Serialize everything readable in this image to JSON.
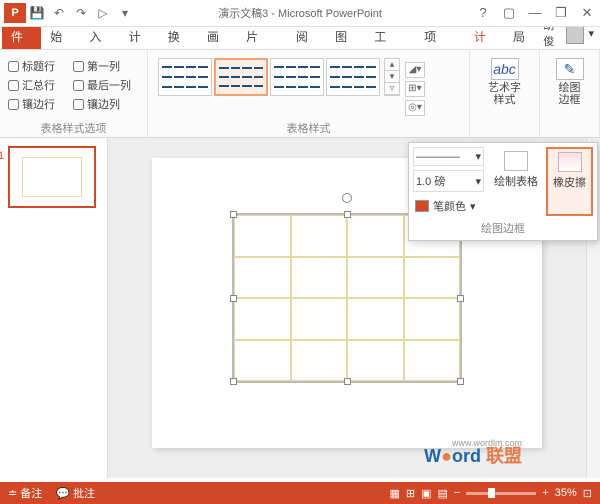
{
  "title": "演示文稿3 - Microsoft PowerPoint",
  "tabs": {
    "file": "文件",
    "start": "开始",
    "insert": "插入",
    "design": "设计",
    "trans": "切换",
    "anim": "动画",
    "slideshow": "幻灯片",
    "review": "审阅",
    "view": "视图",
    "dev": "开发工",
    "addin": "加载项",
    "design2": "设计",
    "layout": "布局"
  },
  "user": "胡俊",
  "checks": {
    "header_row": "标题行",
    "first_col": "第一列",
    "total_row": "汇总行",
    "last_col": "最后一列",
    "banded_row": "镶边行",
    "banded_col": "镶边列"
  },
  "groups": {
    "table_opts": "表格样式选项",
    "table_styles": "表格样式",
    "wordart": "艺术字样式",
    "border": "绘图边框"
  },
  "wordart_btn": "艺术字样式",
  "draw_border": "绘图边框",
  "panel": {
    "line_style": "————",
    "weight": "1.0 磅",
    "pen_color": "笔颜色",
    "draw_table": "绘制表格",
    "eraser": "橡皮擦",
    "label": "绘图边框"
  },
  "status": {
    "notes": "备注",
    "comments": "批注",
    "zoom": "35%"
  },
  "thumb_num": "1",
  "watermark": {
    "w": "W",
    "ord": "ord",
    "brand": "联盟",
    "url": "www.wordlm.com"
  }
}
